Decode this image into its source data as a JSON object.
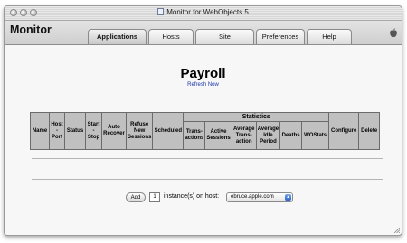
{
  "window": {
    "title": "Monitor for WebObjects 5"
  },
  "header": {
    "app_name": "Monitor",
    "tabs": [
      {
        "label": "Applications",
        "active": true
      },
      {
        "label": "Hosts",
        "active": false
      },
      {
        "label": "Site",
        "active": false
      },
      {
        "label": "Preferences",
        "active": false
      },
      {
        "label": "Help",
        "active": false
      }
    ],
    "logo_icon": "apple-icon"
  },
  "main": {
    "title": "Payroll",
    "refresh_link": "Refresh Now"
  },
  "table": {
    "statistics_header": "Statistics",
    "columns": {
      "name": "Name",
      "host_port": "Host - Port",
      "status": "Status",
      "start_stop": "Start - Stop",
      "auto_recover": "Auto Recover",
      "refuse_new_sessions": "Refuse New Sessions",
      "scheduled": "Scheduled",
      "transactions": "Trans- actions",
      "active_sessions": "Active Sessions",
      "avg_transaction": "Average Trans- action",
      "avg_idle_period": "Average Idle Period",
      "deaths": "Deaths",
      "wostats": "WOStats",
      "configure": "Configure",
      "delete": "Delete"
    }
  },
  "add_instance": {
    "button_label": "Add",
    "count_value": "1",
    "label": "instance(s) on host:",
    "host_selected": "ebruce.apple.com"
  },
  "colors": {
    "table_header_bg": "#c0c0c0",
    "link": "#1a34a8"
  }
}
